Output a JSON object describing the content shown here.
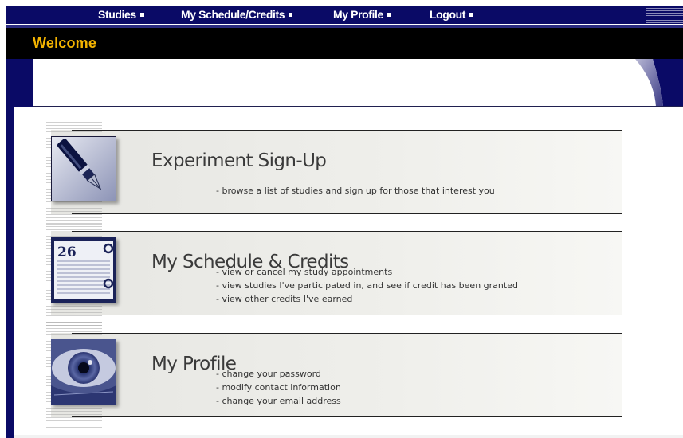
{
  "nav": {
    "items": [
      {
        "label": "Studies"
      },
      {
        "label": "My Schedule/Credits"
      },
      {
        "label": "My Profile"
      },
      {
        "label": "Logout"
      }
    ]
  },
  "header": {
    "title": "Welcome",
    "title_color": "#f3b300",
    "bar_color": "#000000",
    "frame_color": "#0a0a66"
  },
  "sections": [
    {
      "icon": "fountain-pen",
      "title": "Experiment Sign-Up",
      "bullets": [
        "browse a list of studies and sign up for those that interest you"
      ]
    },
    {
      "icon": "calendar-planner",
      "title": "My Schedule & Credits",
      "calendar_day": "26",
      "bullets": [
        "view or cancel my study appointments",
        "view studies I've participated in, and see if credit has been granted",
        "view other credits I've earned"
      ]
    },
    {
      "icon": "eye",
      "title": "My Profile",
      "bullets": [
        "change your password",
        "modify contact information",
        "change your email address"
      ]
    }
  ]
}
